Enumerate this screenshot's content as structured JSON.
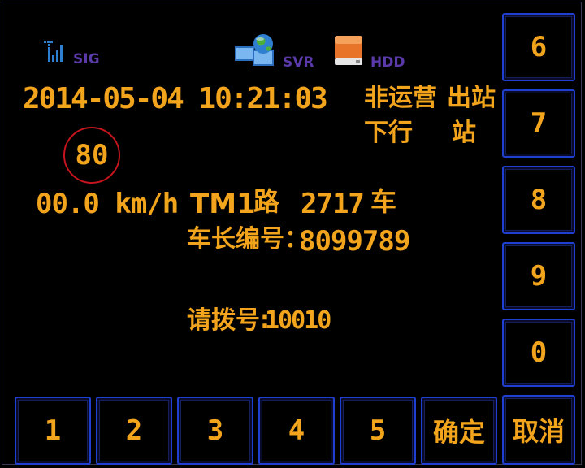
{
  "status": {
    "sig_label": "SIG",
    "svr_label": "SVR",
    "hdd_label": "HDD"
  },
  "datetime": "2014-05-04 10:21:03",
  "service": {
    "mode": "非运营",
    "direction": "下行",
    "station_status": "出站",
    "station": "站"
  },
  "speed_limit": "80",
  "trip": {
    "speed": "00.0 km/h",
    "route": "TM1",
    "route_unit": "路",
    "vehicle": "2717",
    "vehicle_unit": "车"
  },
  "driver": {
    "label": "车长编号：",
    "id": "8099789"
  },
  "dial": {
    "label": "请拨号:",
    "number": "10010"
  },
  "keypad": {
    "right": [
      "6",
      "7",
      "8",
      "9",
      "0"
    ],
    "bottom": [
      "1",
      "2",
      "3",
      "4",
      "5"
    ],
    "confirm": "确定",
    "cancel": "取消"
  },
  "colors": {
    "text": "#f2a41c",
    "status_label": "#5a3aa8",
    "button_border": "#1f3fd0",
    "limit_ring": "#c4141c"
  }
}
